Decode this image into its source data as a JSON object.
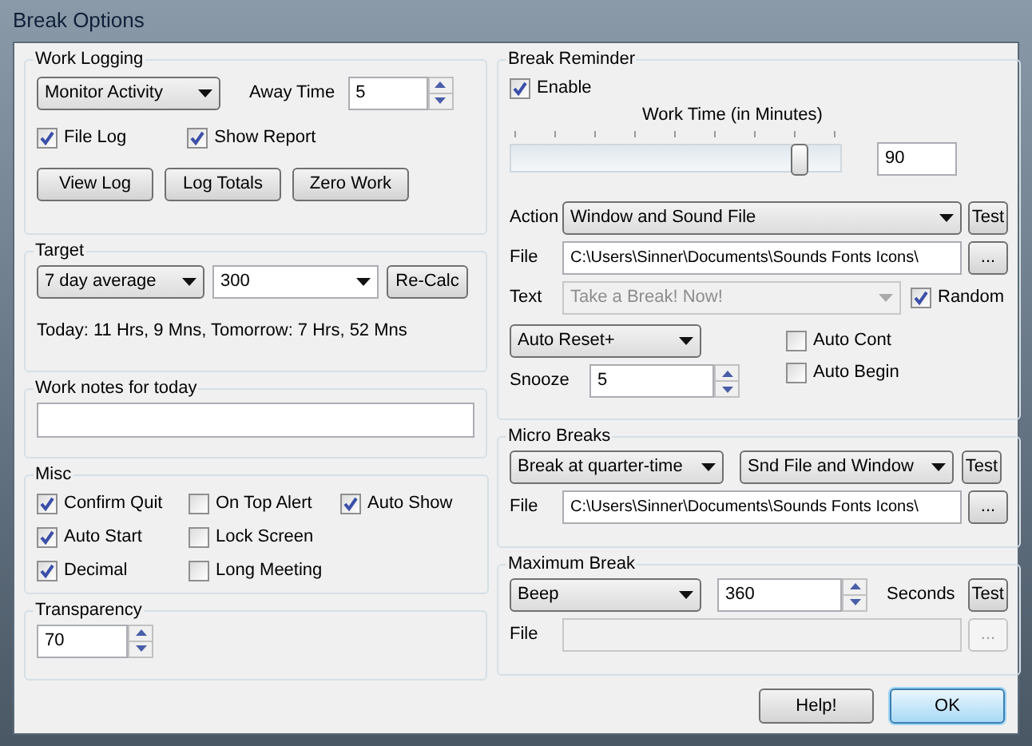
{
  "window": {
    "title": "Break Options"
  },
  "work_logging": {
    "title": "Work Logging",
    "mode": "Monitor Activity",
    "away_label": "Away Time",
    "away_value": "5",
    "checks": [
      {
        "label": "File Log",
        "checked": true
      },
      {
        "label": "Show Report",
        "checked": true
      }
    ],
    "buttons": [
      "View Log",
      "Log Totals",
      "Zero Work"
    ]
  },
  "target": {
    "title": "Target",
    "mode": "7 day average",
    "value": "300",
    "button": "Re-Calc",
    "summary": "Today: 11 Hrs, 9 Mns, Tomorrow: 7 Hrs, 52 Mns"
  },
  "work_notes": {
    "title": "Work notes for today"
  },
  "misc": {
    "title": "Misc",
    "columns": [
      [
        {
          "label": "Confirm Quit",
          "checked": true
        },
        {
          "label": "Auto Start",
          "checked": true
        },
        {
          "label": "Decimal",
          "checked": true
        }
      ],
      [
        {
          "label": "On Top Alert",
          "checked": false
        },
        {
          "label": "Lock Screen",
          "checked": false
        },
        {
          "label": "Long Meeting",
          "checked": false
        }
      ],
      [
        {
          "label": "Auto Show",
          "checked": true
        }
      ]
    ]
  },
  "transparency": {
    "title": "Transparency",
    "value": "70"
  },
  "break_reminder": {
    "title": "Break Reminder",
    "enable": {
      "label": "Enable",
      "checked": true
    },
    "slider_label": "Work Time (in Minutes)",
    "work_time": {
      "level": 0.88
    },
    "work_time_value": "90",
    "action_label": "Action",
    "action": "Window and Sound File",
    "test": "Test",
    "file_label": "File",
    "file": "C:\\Users\\Sinner\\Documents\\Sounds Fonts Icons\\",
    "browse": {
      "label": "...",
      "disabled": false
    },
    "text_label": "Text",
    "text": {
      "value": "Take a Break! Now!",
      "disabled": true
    },
    "random": {
      "label": "Random",
      "checked": true
    },
    "reset_mode": "Auto Reset+",
    "auto_cont": {
      "label": "Auto Cont",
      "checked": false
    },
    "auto_begin": {
      "label": "Auto Begin",
      "checked": false
    },
    "snooze_label": "Snooze",
    "snooze_value": "5"
  },
  "micro_breaks": {
    "title": "Micro Breaks",
    "mode": "Break at quarter-time",
    "action": "Snd File and Window",
    "test": "Test",
    "file_label": "File",
    "file": "C:\\Users\\Sinner\\Documents\\Sounds Fonts Icons\\",
    "browse": {
      "label": "...",
      "disabled": false
    }
  },
  "maximum_break": {
    "title": "Maximum Break",
    "mode": "Beep",
    "value": "360",
    "unit": "Seconds",
    "test": "Test",
    "file_label": "File",
    "file": {
      "disabled": true
    },
    "browse": {
      "label": "...",
      "disabled": true
    }
  },
  "buttons": [
    {
      "label": "Help!",
      "default": false
    },
    {
      "label": "OK",
      "default": true
    }
  ]
}
